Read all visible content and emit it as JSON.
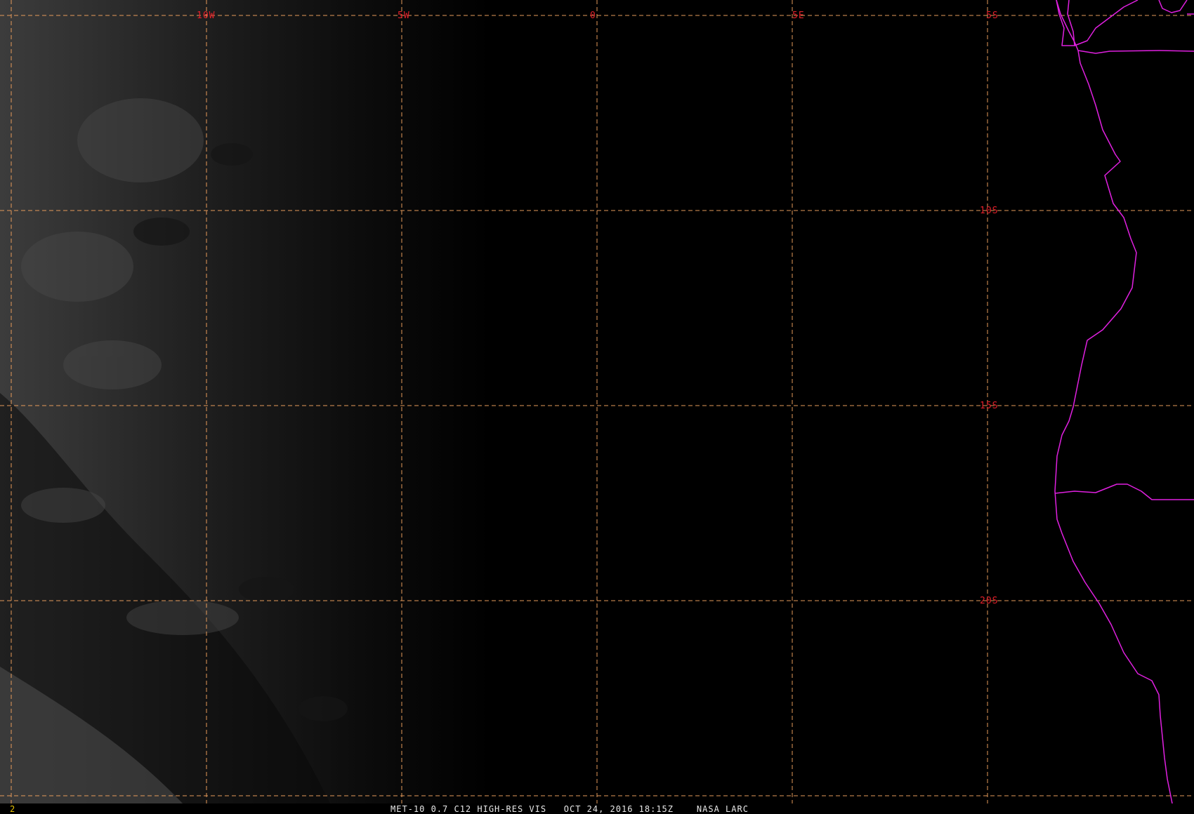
{
  "map": {
    "longitude_labels": [
      "10W",
      "5W",
      "0",
      "5E",
      "5S"
    ],
    "latitude_labels": [
      "10S",
      "15S",
      "20S"
    ],
    "colors": {
      "grid": "#e59a5a",
      "grid_label": "#e0202a",
      "coastline": "#e020e0",
      "background": "#000000"
    }
  },
  "status_bar": {
    "frame_number": "2",
    "caption": "MET-10 0.7 C12 HIGH-RES VIS   OCT 24, 2016 18:15Z    NASA LARC"
  }
}
